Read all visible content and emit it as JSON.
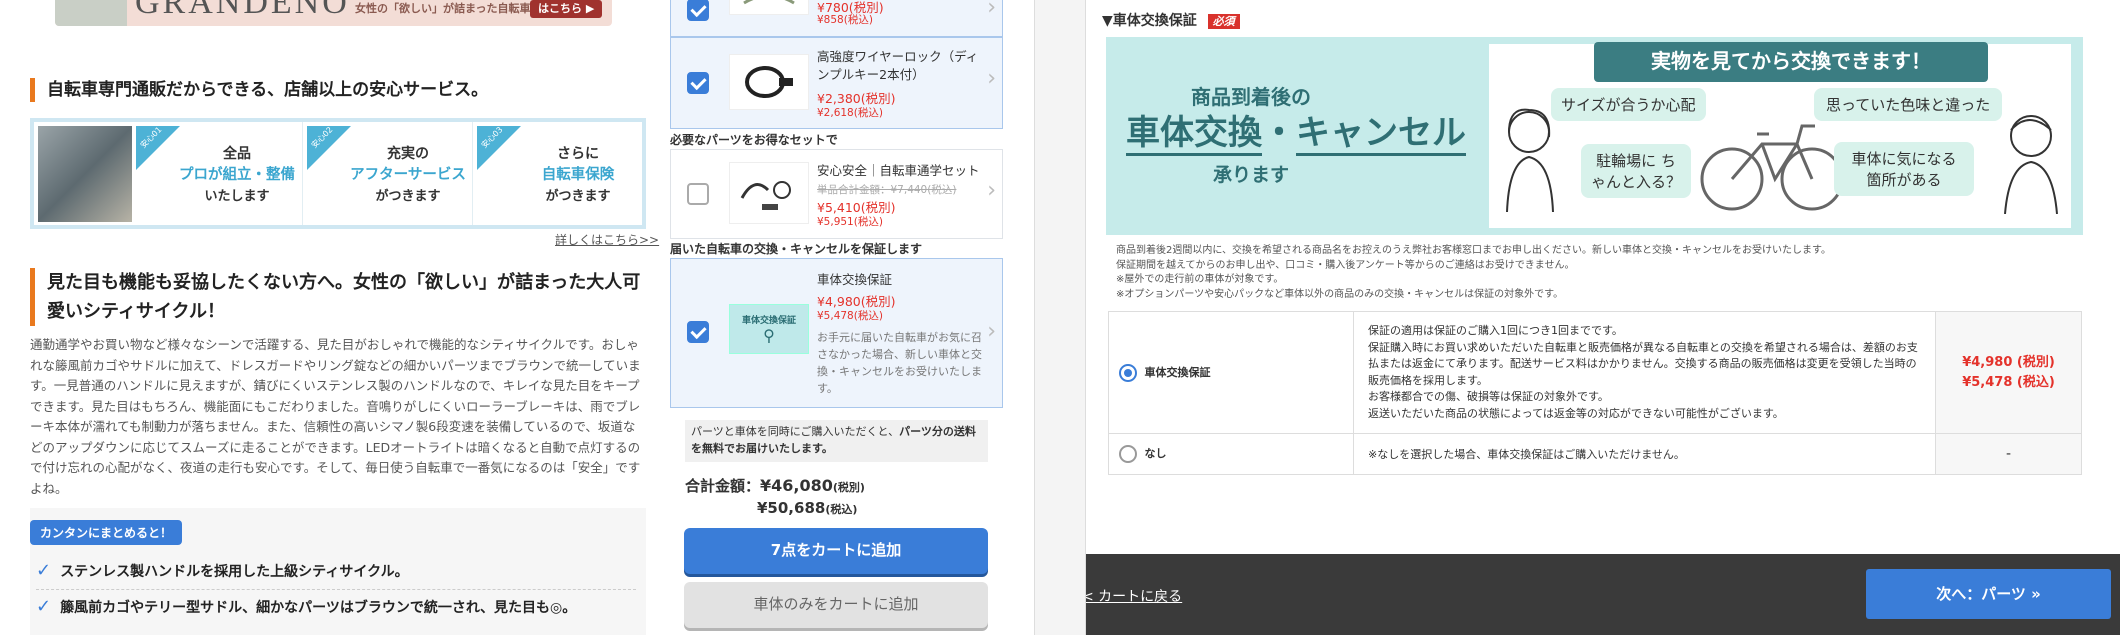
{
  "left": {
    "banner": {
      "brand": "GRANDENO",
      "tagline": "女性の「欲しい」が詰まった自転車",
      "cta": "はこちら ▶"
    },
    "service_heading": "自転車専門通販だからできる、店舗以上の安心サービス。",
    "services": [
      {
        "point": "安心01",
        "line1": "全品",
        "line2": "プロが組立・整備",
        "line3": "いたします"
      },
      {
        "point": "安心02",
        "line1": "充実の",
        "line2": "アフターサービス",
        "line3": "がつきます"
      },
      {
        "point": "安心03",
        "line1": "さらに",
        "line2": "自転車保険",
        "line3": "がつきます"
      }
    ],
    "details_link": "詳しくはこちら>>",
    "product_heading": "見た目も機能も妥協したくない方へ。女性の「欲しい」が詰まった大人可愛いシティサイクル！",
    "description": "通勤通学やお買い物など様々なシーンで活躍する、見た目がおしゃれで機能的なシティサイクルです。おしゃれな籐風前カゴやサドルに加えて、ドレスガードやリング錠などの細かいパーツまでブラウンで統一しています。一見普通のハンドルに見えますが、錆びにくいステンレス製のハンドルなので、キレイな見た目をキープできます。見た目はもちろん、機能面にもこだわりました。音鳴りがしにくいローラーブレーキは、雨でブレーキ本体が濡れても制動力が落ちません。また、信頼性の高いシマノ製6段変速を装備しているので、坂道などのアップダウンに応じてスムーズに走ることができます。LEDオートライトは暗くなると自動で点灯するので付け忘れの心配がなく、夜道の走行も安心です。そして、毎日使う自転車で一番気になるのは「安全」ですよね。",
    "summary_badge": "カンタンにまとめると！",
    "summary_points": [
      "ステンレス製ハンドルを採用した上級シティサイクル。",
      "籐風前カゴやテリー型サドル、細かなパーツはブラウンで統一され、見た目も◎。"
    ]
  },
  "cart": {
    "items_top": [
      {
        "price_tax_ex": "¥780(税別)",
        "price_tax_in": "¥858(税込)",
        "checked": true
      },
      {
        "name": "高強度ワイヤーロック（ディンプルキー2本付）",
        "price_tax_ex": "¥2,380(税別)",
        "price_tax_in": "¥2,618(税込)",
        "checked": true
      }
    ],
    "set_section_label": "必要なパーツをお得なセットで",
    "set_item": {
      "name": "安心安全｜自転車通学セット",
      "strike": "単品合計金額：¥7,440(税込)",
      "price_tax_ex": "¥5,410(税別)",
      "price_tax_in": "¥5,951(税込)",
      "checked": false
    },
    "guarantee_section_label": "届いた自転車の交換・キャンセルを保証します",
    "guarantee_item": {
      "name": "車体交換保証",
      "price_tax_ex": "¥4,980(税別)",
      "price_tax_in": "¥5,478(税込)",
      "desc": "お手元に届いた自転車がお気に召さなかった場合、新しい車体と交換・キャンセルをお受けいたします。",
      "thumb_title": "車体交換保証",
      "checked": true
    },
    "shipping_note_a": "パーツと車体を同時にご購入いただくと、",
    "shipping_note_b": "パーツ分の送料を無料でお届けいたします。",
    "total_label": "合計金額：",
    "total_tax_ex": "¥46,080",
    "tax_ex_suffix": "(税別)",
    "total_tax_in": "¥50,688",
    "tax_in_suffix": "(税込)",
    "add_all_button": "7点をカートに追加",
    "add_body_button": "車体のみをカートに追加"
  },
  "right": {
    "section_title": "▼車体交換保証",
    "required_badge": "必須",
    "banner": {
      "left_line1": "商品到着後の",
      "left_line2a": "車体交換",
      "left_dot": "・",
      "left_line2b": "キャンセル",
      "left_line3": "承ります",
      "ribbon": "実物を見てから交換できます！",
      "bubbles": [
        "サイズが合うか心配",
        "駐輪場に ちゃんと入る？",
        "思っていた色味と違った",
        "車体に気になる 箇所がある"
      ]
    },
    "notes": [
      "商品到着後2週間以内に、交換を希望される商品名をお控えのうえ弊社お客様窓口までお申し出ください。新しい車体と交換・キャンセルをお受けいたします。",
      "保証期間を越えてからのお申し出や、口コミ・購入後アンケート等からのご連絡はお受けできません。",
      "※屋外での走行前の車体が対象です。",
      "※オプションパーツや安心パックなど車体以外の商品のみの交換・キャンセルは保証の対象外です。"
    ],
    "options": [
      {
        "label": "車体交換保証",
        "selected": true,
        "details": [
          "保証の適用は保証のご購入1回につき1回までです。",
          "保証購入時にお買い求めいただいた自転車と販売価格が異なる自転車との交換を希望される場合は、差額のお支払または返金にて承ります。配送サービス料はかかりません。交換する商品の販売価格は変更を受領した当時の販売価格を採用します。",
          "お客様都合での傷、破損等は保証の対象外です。",
          "返送いただいた商品の状態によっては返金等の対応ができない可能性がございます。"
        ],
        "price_tax_ex": "¥4,980 (税別)",
        "price_tax_in": "¥5,478 (税込)"
      },
      {
        "label": "なし",
        "selected": false,
        "details": [
          "※なしを選択した場合、車体交換保証はご購入いただけません。"
        ],
        "price": "-"
      }
    ],
    "back_link": "< カートに戻る",
    "next_button": "次へ：パーツ »"
  },
  "colors": {
    "accent_blue": "#3a7dd8",
    "accent_orange": "#e9791e",
    "price_red": "#e4322b",
    "teal": "#3b7d82",
    "footer_dark": "#3a3a3a"
  }
}
